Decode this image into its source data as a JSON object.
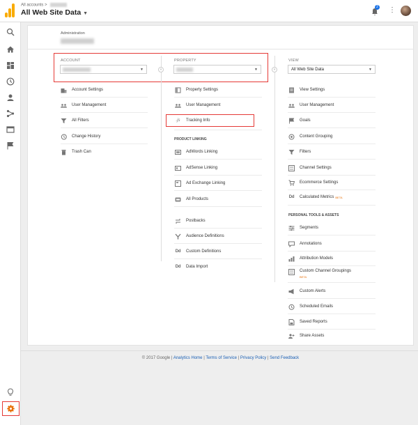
{
  "topbar": {
    "breadcrumb_label": "All accounts",
    "breadcrumb_sep": ">",
    "title": "All Web Site Data",
    "notifications_count": "2"
  },
  "admin": {
    "label": "Administration"
  },
  "account": {
    "label": "ACCOUNT",
    "items": [
      {
        "label": "Account Settings",
        "icon": "building-icon"
      },
      {
        "label": "User Management",
        "icon": "users-icon"
      },
      {
        "label": "All Filters",
        "icon": "filter-icon"
      },
      {
        "label": "Change History",
        "icon": "history-icon"
      },
      {
        "label": "Trash Can",
        "icon": "trash-icon"
      }
    ]
  },
  "property": {
    "label": "PROPERTY",
    "items": [
      {
        "label": "Property Settings",
        "icon": "square-icon"
      },
      {
        "label": "User Management",
        "icon": "users-icon"
      },
      {
        "label": "Tracking Info",
        "icon": "js-icon"
      }
    ],
    "linking_header": "PRODUCT LINKING",
    "linking_items": [
      {
        "label": "AdWords Linking",
        "icon": "adwords-icon"
      },
      {
        "label": "AdSense Linking",
        "icon": "adsense-icon"
      },
      {
        "label": "Ad Exchange Linking",
        "icon": "adexchange-icon"
      },
      {
        "label": "All Products",
        "icon": "products-icon"
      }
    ],
    "other_items": [
      {
        "label": "Postbacks",
        "icon": "postbacks-icon"
      },
      {
        "label": "Audience Definitions",
        "icon": "audience-icon"
      },
      {
        "label": "Custom Definitions",
        "icon": "dd-icon"
      },
      {
        "label": "Data Import",
        "icon": "dd-icon"
      }
    ]
  },
  "view": {
    "label": "VIEW",
    "selected": "All Web Site Data",
    "items": [
      {
        "label": "View Settings",
        "icon": "doc-icon"
      },
      {
        "label": "User Management",
        "icon": "users-icon"
      },
      {
        "label": "Goals",
        "icon": "flag-icon"
      },
      {
        "label": "Content Grouping",
        "icon": "grouping-icon"
      },
      {
        "label": "Filters",
        "icon": "filter-icon"
      },
      {
        "label": "Channel Settings",
        "icon": "channel-icon"
      },
      {
        "label": "Ecommerce Settings",
        "icon": "cart-icon"
      },
      {
        "label": "Calculated Metrics",
        "icon": "dd-icon",
        "badge": "BETA"
      }
    ],
    "personal_header": "PERSONAL TOOLS & ASSETS",
    "personal_items": [
      {
        "label": "Segments",
        "icon": "segments-icon"
      },
      {
        "label": "Annotations",
        "icon": "annotations-icon"
      },
      {
        "label": "Attribution Models",
        "icon": "attribution-icon"
      },
      {
        "label": "Custom Channel Groupings",
        "icon": "custom-channel-icon",
        "badge": "BETA"
      },
      {
        "label": "Custom Alerts",
        "icon": "megaphone-icon"
      },
      {
        "label": "Scheduled Emails",
        "icon": "clock-icon"
      },
      {
        "label": "Saved Reports",
        "icon": "saved-icon"
      },
      {
        "label": "Share Assets",
        "icon": "share-icon"
      }
    ]
  },
  "footer": {
    "copyright": "© 2017 Google |",
    "links": [
      "Analytics Home",
      "Terms of Service",
      "Privacy Policy",
      "Send Feedback"
    ],
    "sep": "|"
  },
  "colors": {
    "highlight": "#e53935",
    "logo": "#f9ab00",
    "link": "#1a5fb4",
    "beta": "#e8710a"
  }
}
